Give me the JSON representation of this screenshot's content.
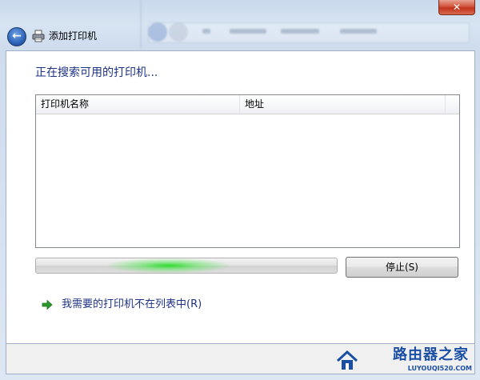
{
  "window": {
    "title": "添加打印机",
    "close_label": "✕"
  },
  "main": {
    "heading": "正在搜索可用的打印机...",
    "columns": [
      "打印机名称",
      "地址"
    ],
    "rows": [],
    "progress": {
      "state": "indeterminate",
      "color": "#2cd62c"
    },
    "stop_button": "停止(S)",
    "not_listed_link": "我需要的打印机不在列表中(R)"
  },
  "watermark": {
    "name": "路由器之家",
    "url": "LUYOUQI520.COM"
  },
  "colors": {
    "heading": "#1e3287",
    "link": "#1e3287",
    "close": "#c3331c",
    "watermark": "#1a4fa5"
  }
}
